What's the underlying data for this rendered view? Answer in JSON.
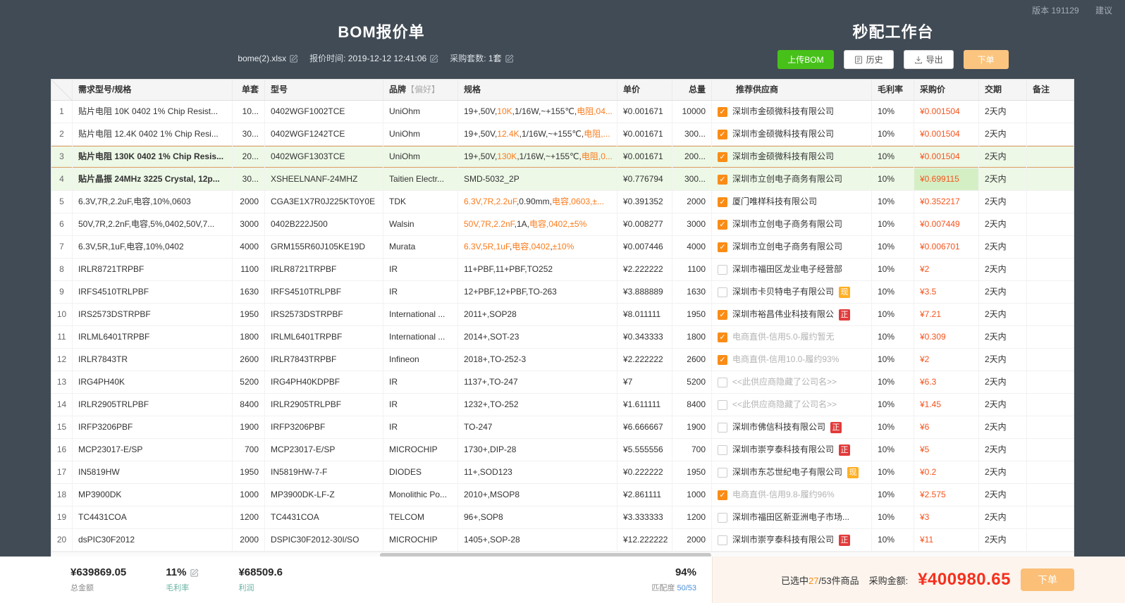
{
  "page": {
    "version_text": "版本 191129",
    "suggestion_text": "建议",
    "left_title": "BOM报价单",
    "right_title": "秒配工作台",
    "file_name": "bome(2).xlsx",
    "quote_time_label": "报价时间:",
    "quote_time": "2019-12-12 12:41:06",
    "set_count_label": "采购套数:",
    "set_count": "1套",
    "btn_upload": "上传BOM",
    "btn_history": "历史",
    "btn_export": "导出",
    "btn_order_top": "下单"
  },
  "icons": {
    "checkmark": "✓"
  },
  "colors": {
    "accent_orange": "#fa8c16",
    "price_orange": "#f5531c",
    "upload_green": "#47c119",
    "row_highlight_green": "#edf8e7",
    "badge_red": "#e23b3b",
    "badge_yellow": "#ffaf24",
    "total_red": "#f5301e"
  },
  "table": {
    "headers": [
      {
        "key": "corner",
        "label": ""
      },
      {
        "key": "demand",
        "label": "需求型号/规格"
      },
      {
        "key": "qty",
        "label": "单套"
      },
      {
        "key": "model",
        "label": "型号"
      },
      {
        "key": "brand",
        "label": "品牌",
        "sub": "【偏好】"
      },
      {
        "key": "spec",
        "label": "规格"
      },
      {
        "key": "price",
        "label": "单价"
      },
      {
        "key": "total",
        "label": "总量"
      },
      {
        "key": "supplier",
        "label": "推荐供应商"
      },
      {
        "key": "margin",
        "label": "毛利率"
      },
      {
        "key": "buy",
        "label": "采购价"
      },
      {
        "key": "delivery",
        "label": "交期"
      },
      {
        "key": "note",
        "label": "备注"
      }
    ],
    "rows": [
      {
        "num": "1",
        "demand": "贴片电阻 10K 0402 1% Chip Resist...",
        "demand_bold": false,
        "qty": "10...",
        "model": "0402WGF1002TCE",
        "brand": "UniOhm",
        "spec": [
          [
            "19+,50V,",
            0
          ],
          [
            "10K",
            1
          ],
          [
            ",1/16W,~+155℃,",
            0
          ],
          [
            "电阻",
            1
          ],
          [
            ",04...",
            1
          ]
        ],
        "price": "¥0.001671",
        "total": "10000",
        "checked": true,
        "supplier": "深圳市金硕微科技有限公司",
        "supplier_gray": false,
        "badge": "",
        "margin": "10%",
        "buy": "¥0.001504",
        "delivery": "2天内",
        "note": "",
        "highlight": false,
        "selected": false,
        "buy_hl": false
      },
      {
        "num": "2",
        "demand": "贴片电阻 12.4K 0402 1% Chip Resi...",
        "demand_bold": false,
        "qty": "30...",
        "model": "0402WGF1242TCE",
        "brand": "UniOhm",
        "spec": [
          [
            "19+,50V,",
            0
          ],
          [
            "12.4K",
            1
          ],
          [
            ",1/16W,~+155℃,",
            0
          ],
          [
            "电阻",
            1
          ],
          [
            ",...",
            1
          ]
        ],
        "price": "¥0.001671",
        "total": "300...",
        "checked": true,
        "supplier": "深圳市金硕微科技有限公司",
        "supplier_gray": false,
        "badge": "",
        "margin": "10%",
        "buy": "¥0.001504",
        "delivery": "2天内",
        "note": "",
        "highlight": false,
        "selected": false,
        "buy_hl": false
      },
      {
        "num": "3",
        "demand": "贴片电阻 130K 0402 1% Chip Resis...",
        "demand_bold": true,
        "qty": "20...",
        "model": "0402WGF1303TCE",
        "brand": "UniOhm",
        "spec": [
          [
            "19+,50V,",
            0
          ],
          [
            "130K",
            1
          ],
          [
            ",1/16W,~+155℃,",
            0
          ],
          [
            "电阻",
            1
          ],
          [
            ",0...",
            1
          ]
        ],
        "price": "¥0.001671",
        "total": "200...",
        "checked": true,
        "supplier": "深圳市金硕微科技有限公司",
        "supplier_gray": false,
        "badge": "",
        "margin": "10%",
        "buy": "¥0.001504",
        "delivery": "2天内",
        "note": "",
        "highlight": true,
        "selected": true,
        "buy_hl": false
      },
      {
        "num": "4",
        "demand": "贴片晶振 24MHz 3225 Crystal, 12p...",
        "demand_bold": true,
        "qty": "30...",
        "model": "XSHEELNANF-24MHZ",
        "brand": "Taitien Electr...",
        "spec": [
          [
            "SMD-5032_2P",
            0
          ]
        ],
        "price": "¥0.776794",
        "total": "300...",
        "checked": true,
        "supplier": "深圳市立创电子商务有限公司",
        "supplier_gray": false,
        "badge": "",
        "margin": "10%",
        "buy": "¥0.699115",
        "delivery": "2天内",
        "note": "",
        "highlight": true,
        "selected": false,
        "buy_hl": true
      },
      {
        "num": "5",
        "demand": "6.3V,7R,2.2uF,电容,10%,0603",
        "demand_bold": false,
        "qty": "2000",
        "model": "CGA3E1X7R0J225KT0Y0E",
        "brand": "TDK",
        "spec": [
          [
            "6.3V,7R,2.2uF",
            1
          ],
          [
            ",0.90mm,",
            0
          ],
          [
            "电容,0603,±...",
            1
          ]
        ],
        "price": "¥0.391352",
        "total": "2000",
        "checked": true,
        "supplier": "厦门唯样科技有限公司",
        "supplier_gray": false,
        "badge": "",
        "margin": "10%",
        "buy": "¥0.352217",
        "delivery": "2天内",
        "note": "",
        "highlight": false,
        "selected": false,
        "buy_hl": false
      },
      {
        "num": "6",
        "demand": "50V,7R,2.2nF,电容,5%,0402,50V,7...",
        "demand_bold": false,
        "qty": "3000",
        "model": "0402B222J500",
        "brand": "Walsin",
        "spec": [
          [
            "50V,7R,2.2nF",
            1
          ],
          [
            ",1A,",
            0
          ],
          [
            "电容,0402,±5%",
            1
          ]
        ],
        "price": "¥0.008277",
        "total": "3000",
        "checked": true,
        "supplier": "深圳市立创电子商务有限公司",
        "supplier_gray": false,
        "badge": "",
        "margin": "10%",
        "buy": "¥0.007449",
        "delivery": "2天内",
        "note": "",
        "highlight": false,
        "selected": false,
        "buy_hl": false
      },
      {
        "num": "7",
        "demand": "6.3V,5R,1uF,电容,10%,0402",
        "demand_bold": false,
        "qty": "4000",
        "model": "GRM155R60J105KE19D",
        "brand": "Murata",
        "spec": [
          [
            "6.3V,5R,1uF",
            1
          ],
          [
            ",",
            0
          ],
          [
            "电容,0402",
            1
          ],
          [
            ",",
            0
          ],
          [
            "±10%",
            1
          ]
        ],
        "price": "¥0.007446",
        "total": "4000",
        "checked": true,
        "supplier": "深圳市立创电子商务有限公司",
        "supplier_gray": false,
        "badge": "",
        "margin": "10%",
        "buy": "¥0.006701",
        "delivery": "2天内",
        "note": "",
        "highlight": false,
        "selected": false,
        "buy_hl": false
      },
      {
        "num": "8",
        "demand": "IRLR8721TRPBF",
        "demand_bold": false,
        "qty": "1100",
        "model": "IRLR8721TRPBF",
        "brand": "IR",
        "spec": [
          [
            "11+PBF,11+PBF,TO252",
            0
          ]
        ],
        "price": "¥2.222222",
        "total": "1100",
        "checked": false,
        "supplier": "深圳市福田区龙业电子经营部",
        "supplier_gray": false,
        "badge": "",
        "margin": "10%",
        "buy": "¥2",
        "delivery": "2天内",
        "note": "",
        "highlight": false,
        "selected": false,
        "buy_hl": false
      },
      {
        "num": "9",
        "demand": "IRFS4510TRLPBF",
        "demand_bold": false,
        "qty": "1630",
        "model": "IRFS4510TRLPBF",
        "brand": "IR",
        "spec": [
          [
            "12+PBF,12+PBF,TO-263",
            0
          ]
        ],
        "price": "¥3.888889",
        "total": "1630",
        "checked": false,
        "supplier": "深圳市卡贝特电子有限公司",
        "supplier_gray": false,
        "badge": "现",
        "margin": "10%",
        "buy": "¥3.5",
        "delivery": "2天内",
        "note": "",
        "highlight": false,
        "selected": false,
        "buy_hl": false
      },
      {
        "num": "10",
        "demand": "IRS2573DSTRPBF",
        "demand_bold": false,
        "qty": "1950",
        "model": "IRS2573DSTRPBF",
        "brand": "International ...",
        "spec": [
          [
            "2011+,SOP28",
            0
          ]
        ],
        "price": "¥8.011111",
        "total": "1950",
        "checked": true,
        "supplier": "深圳市裕昌伟业科技有限公",
        "supplier_gray": false,
        "badge": "正",
        "margin": "10%",
        "buy": "¥7.21",
        "delivery": "2天内",
        "note": "",
        "highlight": false,
        "selected": false,
        "buy_hl": false
      },
      {
        "num": "11",
        "demand": "IRLML6401TRPBF",
        "demand_bold": false,
        "qty": "1800",
        "model": "IRLML6401TRPBF",
        "brand": "International ...",
        "spec": [
          [
            "2014+,SOT-23",
            0
          ]
        ],
        "price": "¥0.343333",
        "total": "1800",
        "checked": true,
        "supplier": "电商直供-信用5.0-履约暂无",
        "supplier_gray": true,
        "badge": "",
        "margin": "10%",
        "buy": "¥0.309",
        "delivery": "2天内",
        "note": "",
        "highlight": false,
        "selected": false,
        "buy_hl": false
      },
      {
        "num": "12",
        "demand": "IRLR7843TR",
        "demand_bold": false,
        "qty": "2600",
        "model": "IRLR7843TRPBF",
        "brand": "Infineon",
        "spec": [
          [
            "2018+,TO-252-3",
            0
          ]
        ],
        "price": "¥2.222222",
        "total": "2600",
        "checked": true,
        "supplier": "电商直供-信用10.0-履约93%",
        "supplier_gray": true,
        "badge": "",
        "margin": "10%",
        "buy": "¥2",
        "delivery": "2天内",
        "note": "",
        "highlight": false,
        "selected": false,
        "buy_hl": false
      },
      {
        "num": "13",
        "demand": "IRG4PH40K",
        "demand_bold": false,
        "qty": "5200",
        "model": "IRG4PH40KDPBF",
        "brand": "IR",
        "spec": [
          [
            "1137+,TO-247",
            0
          ]
        ],
        "price": "¥7",
        "total": "5200",
        "checked": false,
        "supplier": "<<此供应商隐藏了公司名>>",
        "supplier_gray": true,
        "badge": "",
        "margin": "10%",
        "buy": "¥6.3",
        "delivery": "2天内",
        "note": "",
        "highlight": false,
        "selected": false,
        "buy_hl": false
      },
      {
        "num": "14",
        "demand": "IRLR2905TRLPBF",
        "demand_bold": false,
        "qty": "8400",
        "model": "IRLR2905TRLPBF",
        "brand": "IR",
        "spec": [
          [
            "1232+,TO-252",
            0
          ]
        ],
        "price": "¥1.611111",
        "total": "8400",
        "checked": false,
        "supplier": "<<此供应商隐藏了公司名>>",
        "supplier_gray": true,
        "badge": "",
        "margin": "10%",
        "buy": "¥1.45",
        "delivery": "2天内",
        "note": "",
        "highlight": false,
        "selected": false,
        "buy_hl": false
      },
      {
        "num": "15",
        "demand": "IRFP3206PBF",
        "demand_bold": false,
        "qty": "1900",
        "model": "IRFP3206PBF",
        "brand": "IR",
        "spec": [
          [
            "TO-247",
            0
          ]
        ],
        "price": "¥6.666667",
        "total": "1900",
        "checked": false,
        "supplier": "深圳市佛信科技有限公司",
        "supplier_gray": false,
        "badge": "正",
        "margin": "10%",
        "buy": "¥6",
        "delivery": "2天内",
        "note": "",
        "highlight": false,
        "selected": false,
        "buy_hl": false
      },
      {
        "num": "16",
        "demand": "MCP23017-E/SP",
        "demand_bold": false,
        "qty": "700",
        "model": "MCP23017-E/SP",
        "brand": "MICROCHIP",
        "spec": [
          [
            "1730+,DIP-28",
            0
          ]
        ],
        "price": "¥5.555556",
        "total": "700",
        "checked": false,
        "supplier": "深圳市崇亨泰科技有限公司",
        "supplier_gray": false,
        "badge": "正",
        "margin": "10%",
        "buy": "¥5",
        "delivery": "2天内",
        "note": "",
        "highlight": false,
        "selected": false,
        "buy_hl": false
      },
      {
        "num": "17",
        "demand": "IN5819HW",
        "demand_bold": false,
        "qty": "1950",
        "model": "IN5819HW-7-F",
        "brand": "DIODES",
        "spec": [
          [
            "11+,SOD123",
            0
          ]
        ],
        "price": "¥0.222222",
        "total": "1950",
        "checked": false,
        "supplier": "深圳市东芯世纪电子有限公司",
        "supplier_gray": false,
        "badge": "现",
        "margin": "10%",
        "buy": "¥0.2",
        "delivery": "2天内",
        "note": "",
        "highlight": false,
        "selected": false,
        "buy_hl": false
      },
      {
        "num": "18",
        "demand": "MP3900DK",
        "demand_bold": false,
        "qty": "1000",
        "model": "MP3900DK-LF-Z",
        "brand": "Monolithic Po...",
        "spec": [
          [
            "2010+,MSOP8",
            0
          ]
        ],
        "price": "¥2.861111",
        "total": "1000",
        "checked": true,
        "supplier": "电商直供-信用9.8-履约96%",
        "supplier_gray": true,
        "badge": "",
        "margin": "10%",
        "buy": "¥2.575",
        "delivery": "2天内",
        "note": "",
        "highlight": false,
        "selected": false,
        "buy_hl": false
      },
      {
        "num": "19",
        "demand": "TC4431COA",
        "demand_bold": false,
        "qty": "1200",
        "model": "TC4431COA",
        "brand": "TELCOM",
        "spec": [
          [
            "96+,SOP8",
            0
          ]
        ],
        "price": "¥3.333333",
        "total": "1200",
        "checked": false,
        "supplier": "深圳市福田区新亚洲电子市场...",
        "supplier_gray": false,
        "badge": "",
        "margin": "10%",
        "buy": "¥3",
        "delivery": "2天内",
        "note": "",
        "highlight": false,
        "selected": false,
        "buy_hl": false
      },
      {
        "num": "20",
        "demand": "dsPIC30F2012",
        "demand_bold": false,
        "qty": "2000",
        "model": "DSPIC30F2012-30I/SO",
        "brand": "MICROCHIP",
        "spec": [
          [
            "1405+,SOP-28",
            0
          ]
        ],
        "price": "¥12.222222",
        "total": "2000",
        "checked": false,
        "supplier": "深圳市崇亨泰科技有限公司",
        "supplier_gray": false,
        "badge": "正",
        "margin": "10%",
        "buy": "¥11",
        "delivery": "2天内",
        "note": "",
        "highlight": false,
        "selected": false,
        "buy_hl": false
      }
    ]
  },
  "footer": {
    "total_amount": "¥639869.05",
    "total_amount_label": "总金额",
    "margin": "11%",
    "margin_label": "毛利率",
    "profit": "¥68509.6",
    "profit_label": "利润",
    "match_percent": "94%",
    "match_label": "匹配度",
    "match_ratio": "50/53",
    "selected_prefix": "已选中",
    "selected_count": "27",
    "selected_suffix": "/53件商品",
    "purchase_label": "采购金额:",
    "purchase_amount": "¥400980.65",
    "btn_order": "下单"
  }
}
